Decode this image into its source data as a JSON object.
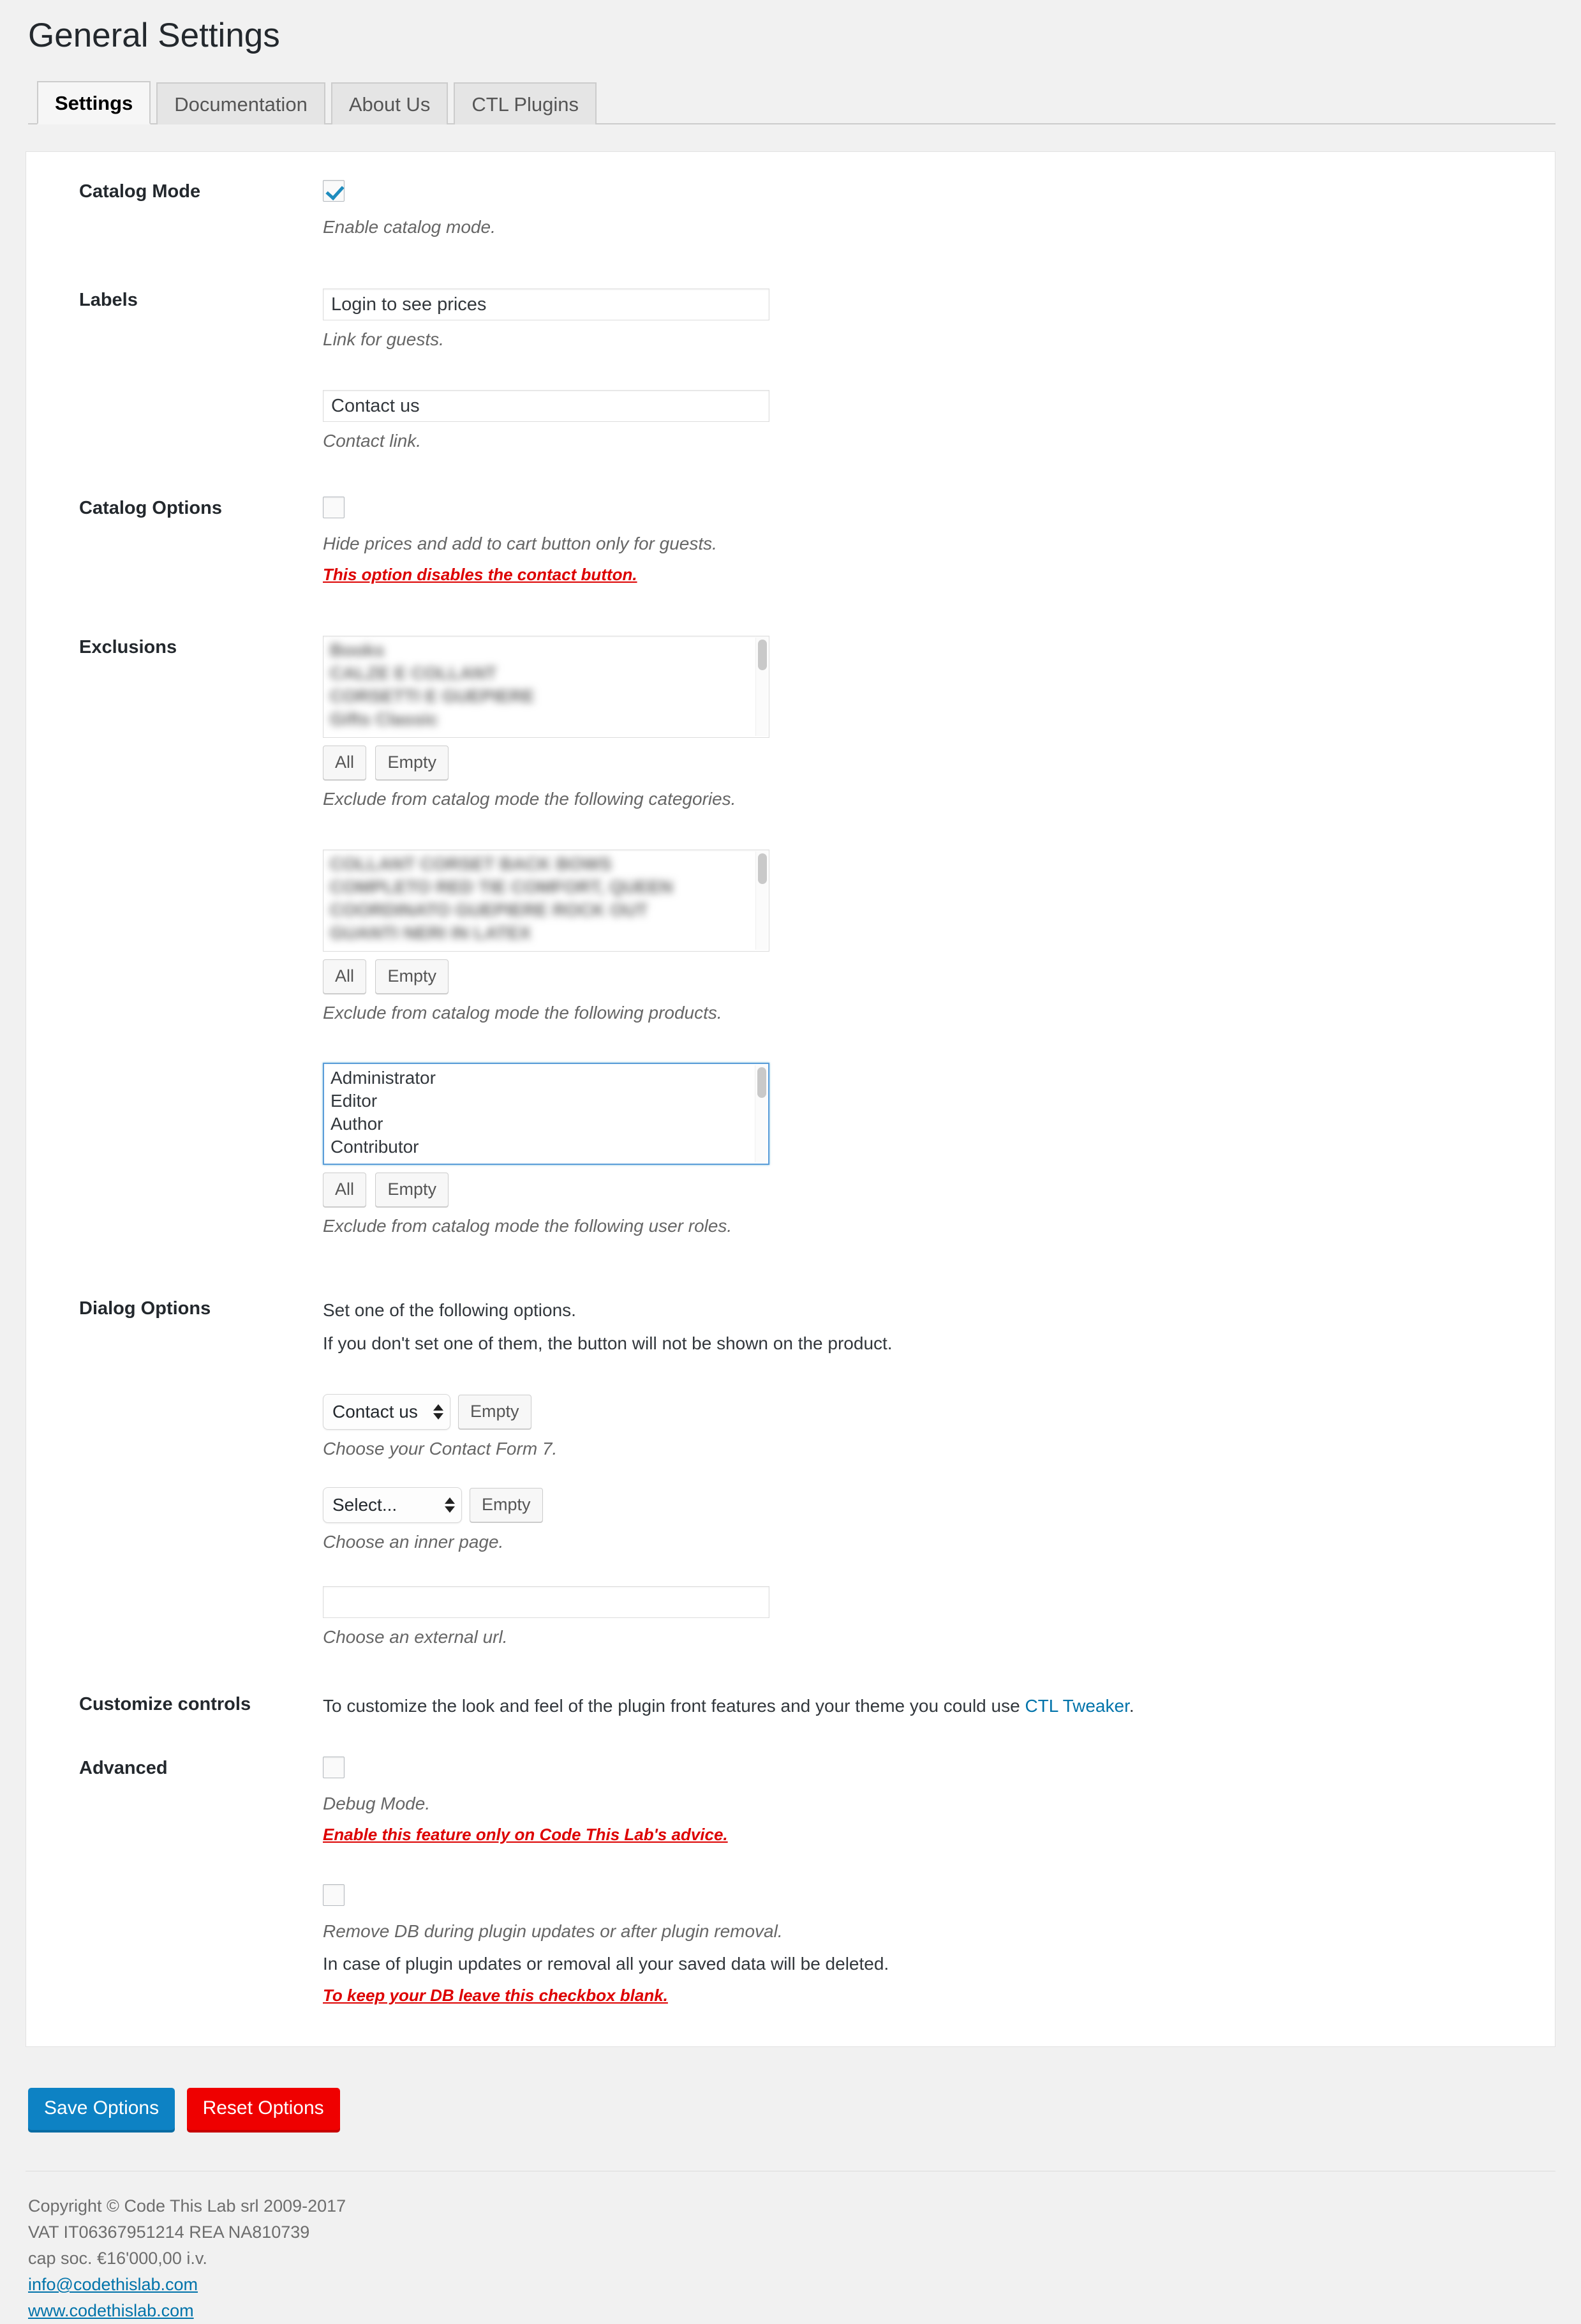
{
  "page": {
    "title": "General Settings"
  },
  "tabs": [
    {
      "label": "Settings",
      "active": true
    },
    {
      "label": "Documentation",
      "active": false
    },
    {
      "label": "About Us",
      "active": false
    },
    {
      "label": "CTL Plugins",
      "active": false
    }
  ],
  "sections": {
    "catalog_mode": {
      "label": "Catalog Mode",
      "checkbox_checked": true,
      "desc": "Enable catalog mode."
    },
    "labels": {
      "label": "Labels",
      "guest_link_value": "Login to see prices",
      "guest_link_desc": "Link for guests.",
      "contact_link_value": "Contact us",
      "contact_link_desc": "Contact link."
    },
    "catalog_options": {
      "label": "Catalog Options",
      "checkbox_checked": false,
      "desc": "Hide prices and add to cart button only for guests.",
      "warning": "This option disables the contact button."
    },
    "exclusions": {
      "label": "Exclusions",
      "categories": {
        "items": [
          "Books",
          "CALZE E COLLANT",
          "CORSETTI E GUEPIERE",
          "Gifts Classic"
        ],
        "blurred": true,
        "all_label": "All",
        "empty_label": "Empty",
        "desc": "Exclude from catalog mode the following categories."
      },
      "products": {
        "items": [
          "COLLANT CORSET BACK BOWS",
          "COMPLETO RED TIE COMFORT, QUEEN",
          "COORDINATO GUEPIERE ROCK OUT",
          "GUANTI NERI IN LATEX"
        ],
        "blurred": true,
        "all_label": "All",
        "empty_label": "Empty",
        "desc": "Exclude from catalog mode the following products."
      },
      "roles": {
        "items": [
          "Administrator",
          "Editor",
          "Author",
          "Contributor"
        ],
        "blurred": false,
        "focused": true,
        "all_label": "All",
        "empty_label": "Empty",
        "desc": "Exclude from catalog mode the following user roles."
      }
    },
    "dialog_options": {
      "label": "Dialog Options",
      "line1": "Set one of the following options.",
      "line2": "If you don't set one of them, the button will not be shown on the product.",
      "cf7_selected": "Contact us",
      "cf7_empty_label": "Empty",
      "cf7_desc": "Choose your Contact Form 7.",
      "page_selected": "Select...",
      "page_empty_label": "Empty",
      "page_desc": "Choose an inner page.",
      "url_value": "",
      "url_desc": "Choose an external url."
    },
    "customize_controls": {
      "label": "Customize controls",
      "text_before": "To customize the look and feel of the plugin front features and your theme you could use ",
      "link_text": "CTL Tweaker",
      "text_after": "."
    },
    "advanced": {
      "label": "Advanced",
      "debug_checked": false,
      "debug_desc": "Debug Mode.",
      "debug_warning": "Enable this feature only on Code This Lab's advice.",
      "removedb_checked": false,
      "removedb_desc": "Remove DB during plugin updates or after plugin removal.",
      "removedb_note": "In case of plugin updates or removal all your saved data will be deleted.",
      "removedb_warning": "To keep your DB leave this checkbox blank."
    }
  },
  "actions": {
    "save_label": "Save Options",
    "reset_label": "Reset Options"
  },
  "footer": {
    "copyright": "Copyright © Code This Lab srl 2009-2017",
    "vat": "VAT IT06367951214 REA NA810739",
    "capital": "cap soc. €16'000,00 i.v.",
    "email": "info@codethislab.com",
    "website": "www.codethislab.com"
  },
  "colors": {
    "accent_blue": "#0073aa",
    "save_blue": "#0d82c4",
    "reset_red": "#ef0000",
    "warning_red": "#dd0000",
    "checkbox_check": "#1e8cbe"
  }
}
